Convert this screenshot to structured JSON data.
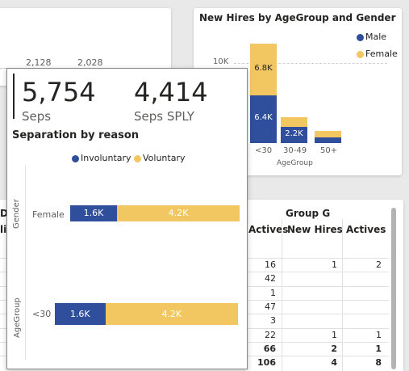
{
  "left_card": {
    "values": [
      "2,128",
      "2,028"
    ]
  },
  "new_hires_chart": {
    "title": "New Hires by AgeGroup and Gender",
    "legend": [
      "Male",
      "Female"
    ],
    "y_tick": "10K",
    "x_axis_label": "AgeGroup",
    "colors": {
      "male": "#2f4f9c",
      "female": "#f2c660"
    },
    "chart_data": {
      "type": "bar",
      "stacked": true,
      "title": "New Hires by AgeGroup and Gender",
      "xlabel": "AgeGroup",
      "categories": [
        "<30",
        "30-49",
        "50+"
      ],
      "series": [
        {
          "name": "Male",
          "values": [
            6400,
            2200,
            800
          ],
          "labels": [
            "6.4K",
            "2.2K",
            ""
          ]
        },
        {
          "name": "Female",
          "values": [
            6800,
            1200,
            800
          ],
          "labels": [
            "6.8K",
            "",
            ""
          ]
        }
      ],
      "ylim": [
        0,
        14000
      ]
    }
  },
  "table": {
    "group_partial": "D",
    "hire_partial": "lire",
    "group_g": "Group G",
    "col_actives_1": "Actives",
    "col_new_hires": "New Hires",
    "col_actives_2": "Actives",
    "actives_1": [
      "16",
      "42",
      "1",
      "47",
      "3",
      "22",
      "66",
      "106"
    ],
    "new_hires": [
      "1",
      "",
      "",
      "",
      "",
      "1",
      "2",
      "4"
    ],
    "actives_2": [
      "2",
      "",
      "",
      "",
      "",
      "1",
      "1",
      "8"
    ]
  },
  "tooltip": {
    "kpi1": {
      "value": "5,754",
      "label": "Seps"
    },
    "kpi2": {
      "value": "4,414",
      "label": "Seps SPLY"
    },
    "chart_title": "Separation by reason",
    "legend": [
      "Involuntary",
      "Voluntary"
    ],
    "colors": {
      "involuntary": "#2f4f9c",
      "voluntary": "#f2c660"
    },
    "groups": [
      {
        "dimension": "Gender",
        "category": "Female",
        "involuntary": "1.6K",
        "voluntary": "4.2K"
      },
      {
        "dimension": "AgeGroup",
        "category": "<30",
        "involuntary": "1.6K",
        "voluntary": "4.2K"
      }
    ],
    "chart_data": {
      "type": "bar",
      "orientation": "horizontal",
      "stacked": true,
      "title": "Separation by reason",
      "categories": [
        "Female",
        "<30"
      ],
      "series": [
        {
          "name": "Involuntary",
          "values": [
            1600,
            1600
          ]
        },
        {
          "name": "Voluntary",
          "values": [
            4200,
            4200
          ]
        }
      ]
    }
  }
}
